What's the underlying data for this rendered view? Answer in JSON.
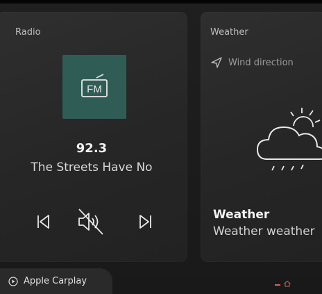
{
  "radio": {
    "title": "Radio",
    "logo_text": "FM",
    "frequency": "92.3",
    "song": "The Streets Have No",
    "controls": {
      "prev_icon": "skip-previous-icon",
      "mute_icon": "speaker-muted-icon",
      "next_icon": "skip-next-icon"
    },
    "accent_color": "#2f5d55"
  },
  "weather": {
    "title": "Weather",
    "wind_label": "Wind direction",
    "wind_icon": "navigation-arrow-icon",
    "condition_icon": "cloud-rain-sun-icon",
    "heading": "Weather",
    "subtext": "Weather weather"
  },
  "dock": {
    "carplay_label": "Apple Carplay",
    "carplay_icon": "play-circle-icon",
    "page_indicator_color": "#d36565"
  }
}
